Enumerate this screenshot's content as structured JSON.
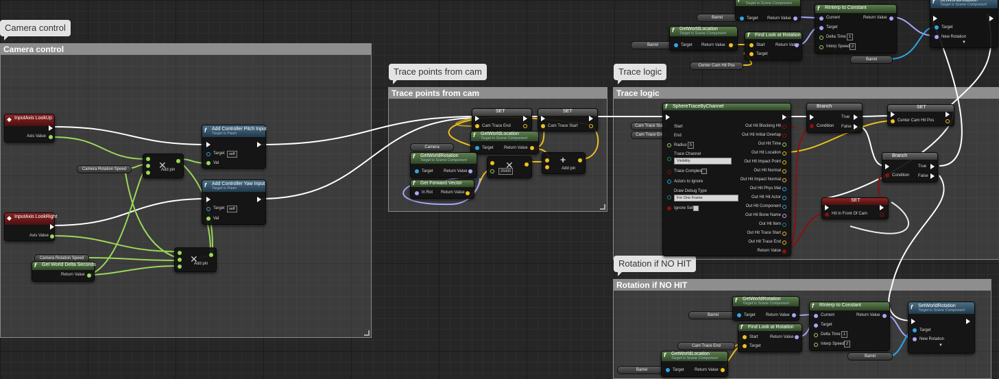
{
  "comments": {
    "camera_control": "Camera control",
    "trace_points": "Trace points from cam",
    "trace_logic": "Trace logic",
    "rotation_no_hit": "Rotation if NO HIT"
  },
  "nodes": {
    "input_lookup": {
      "title": "InputAxis LookUp",
      "out": "Axis Value"
    },
    "input_lookright": {
      "title": "InputAxis LookRight",
      "out": "Axis Value"
    },
    "cam_rot_speed_var1": "Camera Rotation Speed",
    "cam_rot_speed_var2": "Camera Rotation Speed",
    "add_pin_label": "Add pin",
    "pitch": {
      "title": "Add Controller Pitch Input",
      "sub": "Target is Pawn",
      "target": "Target",
      "self": "self",
      "val": "Val"
    },
    "yaw": {
      "title": "Add Controller Yaw Input",
      "sub": "Target is Pawn",
      "target": "Target",
      "self": "self",
      "val": "Val"
    },
    "delta": {
      "title": "Get World Delta Seconds",
      "out": "Return Value"
    },
    "set1": {
      "title": "SET",
      "pin": "Cam Trace End"
    },
    "set2": {
      "title": "SET",
      "pin": "Cam Trace Start"
    },
    "camera_var": "Camera",
    "get_world_location": {
      "title": "GetWorldLocation",
      "sub": "Target is Scene Component",
      "target": "Target",
      "out": "Return Value"
    },
    "get_world_rotation": {
      "title": "GetWorldRotation",
      "sub": "Target is Scene Component",
      "target": "Target",
      "out": "Return Value"
    },
    "get_forward": {
      "title": "Get Forward Vector",
      "in": "In Rot",
      "out": "Return Value"
    },
    "mul_value": "25000",
    "sphere": {
      "title": "SphereTraceByChannel",
      "start": "Start",
      "end": "End",
      "radius": "Radius",
      "radius_val": "5",
      "trace_channel": "Trace Channel",
      "visibility": "Visibility",
      "trace_complex": "Trace Complex",
      "actors_ignore": "Actors to Ignore",
      "draw_debug": "Draw Debug Type",
      "for_one_frame": "For One Frame",
      "ignore_self": "Ignore Self",
      "outs": [
        "Out Hit Blocking Hit",
        "Out Hit Initial Overlap",
        "Out Hit Time",
        "Out Hit Location",
        "Out Hit Impact Point",
        "Out Hit Normal",
        "Out Hit Impact Normal",
        "Out Hit Phys Mat",
        "Out Hit Hit Actor",
        "Out Hit Component",
        "Out Hit Bone Name",
        "Out Hit Item",
        "Out Hit Trace Start",
        "Out Hit Trace End",
        "Return Value"
      ]
    },
    "cam_trace_start_var": "Cam Trace Start",
    "cam_trace_end_var": "Cam Trace End",
    "branch": {
      "title": "Branch",
      "cond": "Condition",
      "true": "True",
      "false": "False"
    },
    "set_center": {
      "title": "SET",
      "pin": "Center Cam Hit Pos"
    },
    "set_hit": {
      "title": "SET",
      "pin": "Hit In Front Of Cam"
    },
    "barrel": "Barrel",
    "find_look": {
      "title": "Find Look at Rotation",
      "start": "Start",
      "target": "Target",
      "out": "Return Value"
    },
    "rinterp": {
      "title": "RInterp to Constant",
      "current": "Current",
      "target": "Target",
      "dt": "Delta Time",
      "dt_val": "1",
      "speed": "Interp Speed",
      "speed_val": "2",
      "out": "Return Value"
    },
    "set_world_rotation": {
      "title": "SetWorldRotation",
      "sub": "Target is Scene Component",
      "target": "Target",
      "new_rot": "New Rotation"
    },
    "center_cam_hit_var": "Center Cam Hit Pos"
  }
}
